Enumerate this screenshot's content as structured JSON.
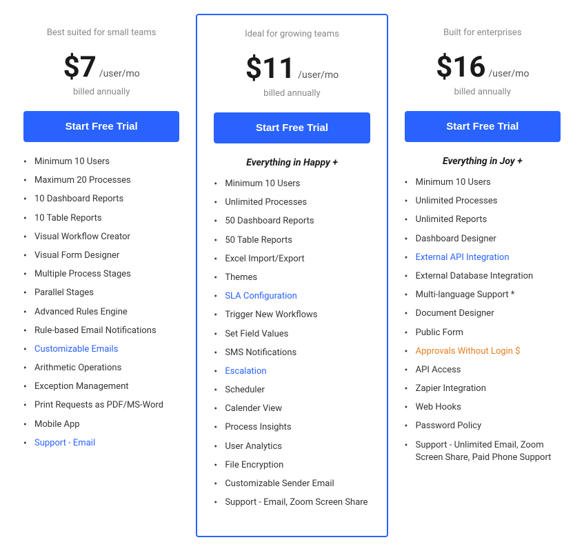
{
  "plans": [
    {
      "id": "happy",
      "subtitle": "Best suited for small teams",
      "price": "$7",
      "period": "/user/mo",
      "billing": "billed annually",
      "button_label": "Start Free Trial",
      "featured": false,
      "everything_note": null,
      "features": [
        {
          "text": "Minimum 10 Users",
          "style": "normal"
        },
        {
          "text": "Maximum 20 Processes",
          "style": "normal"
        },
        {
          "text": "10 Dashboard Reports",
          "style": "normal"
        },
        {
          "text": "10 Table Reports",
          "style": "normal"
        },
        {
          "text": "Visual Workflow Creator",
          "style": "normal"
        },
        {
          "text": "Visual Form Designer",
          "style": "normal"
        },
        {
          "text": "Multiple Process Stages",
          "style": "normal"
        },
        {
          "text": "Parallel Stages",
          "style": "normal"
        },
        {
          "text": "Advanced Rules Engine",
          "style": "normal"
        },
        {
          "text": "Rule-based Email Notifications",
          "style": "normal"
        },
        {
          "text": "Customizable Emails",
          "style": "highlight"
        },
        {
          "text": "Arithmetic Operations",
          "style": "normal"
        },
        {
          "text": "Exception Management",
          "style": "normal"
        },
        {
          "text": "Print Requests as PDF/MS-Word",
          "style": "normal"
        },
        {
          "text": "Mobile App",
          "style": "normal"
        },
        {
          "text": "Support - Email",
          "style": "highlight"
        }
      ]
    },
    {
      "id": "joy",
      "subtitle": "Ideal for growing teams",
      "price": "$11",
      "period": "/user/mo",
      "billing": "billed annually",
      "button_label": "Start Free Trial",
      "featured": true,
      "everything_note": "Everything in Happy +",
      "features": [
        {
          "text": "Minimum 10 Users",
          "style": "normal"
        },
        {
          "text": "Unlimited Processes",
          "style": "normal"
        },
        {
          "text": "50 Dashboard Reports",
          "style": "normal"
        },
        {
          "text": "50 Table Reports",
          "style": "normal"
        },
        {
          "text": "Excel Import/Export",
          "style": "normal"
        },
        {
          "text": "Themes",
          "style": "normal"
        },
        {
          "text": "SLA Configuration",
          "style": "highlight"
        },
        {
          "text": "Trigger New Workflows",
          "style": "normal"
        },
        {
          "text": "Set Field Values",
          "style": "normal"
        },
        {
          "text": "SMS Notifications",
          "style": "normal"
        },
        {
          "text": "Escalation",
          "style": "highlight"
        },
        {
          "text": "Scheduler",
          "style": "normal"
        },
        {
          "text": "Calender View",
          "style": "normal"
        },
        {
          "text": "Process Insights",
          "style": "normal"
        },
        {
          "text": "User Analytics",
          "style": "normal"
        },
        {
          "text": "File Encryption",
          "style": "normal"
        },
        {
          "text": "Customizable Sender Email",
          "style": "normal"
        },
        {
          "text": "Support - Email, Zoom Screen Share",
          "style": "normal"
        }
      ]
    },
    {
      "id": "enterprise",
      "subtitle": "Built for enterprises",
      "price": "$16",
      "period": "/user/mo",
      "billing": "billed annually",
      "button_label": "Start Free Trial",
      "featured": false,
      "everything_note": "Everything in Joy +",
      "features": [
        {
          "text": "Minimum 10 Users",
          "style": "normal"
        },
        {
          "text": "Unlimited Processes",
          "style": "normal"
        },
        {
          "text": "Unlimited Reports",
          "style": "normal"
        },
        {
          "text": "Dashboard Designer",
          "style": "normal"
        },
        {
          "text": "External API Integration",
          "style": "highlight"
        },
        {
          "text": "External Database Integration",
          "style": "normal"
        },
        {
          "text": "Multi-language Support *",
          "style": "normal"
        },
        {
          "text": "Document Designer",
          "style": "normal"
        },
        {
          "text": "Public Form",
          "style": "normal"
        },
        {
          "text": "Approvals Without Login $",
          "style": "orange"
        },
        {
          "text": "API Access",
          "style": "normal"
        },
        {
          "text": "Zapier Integration",
          "style": "normal"
        },
        {
          "text": "Web Hooks",
          "style": "normal"
        },
        {
          "text": "Password Policy",
          "style": "normal"
        },
        {
          "text": "Support - Unlimited Email, Zoom Screen Share, Paid Phone Support",
          "style": "normal"
        }
      ]
    }
  ]
}
